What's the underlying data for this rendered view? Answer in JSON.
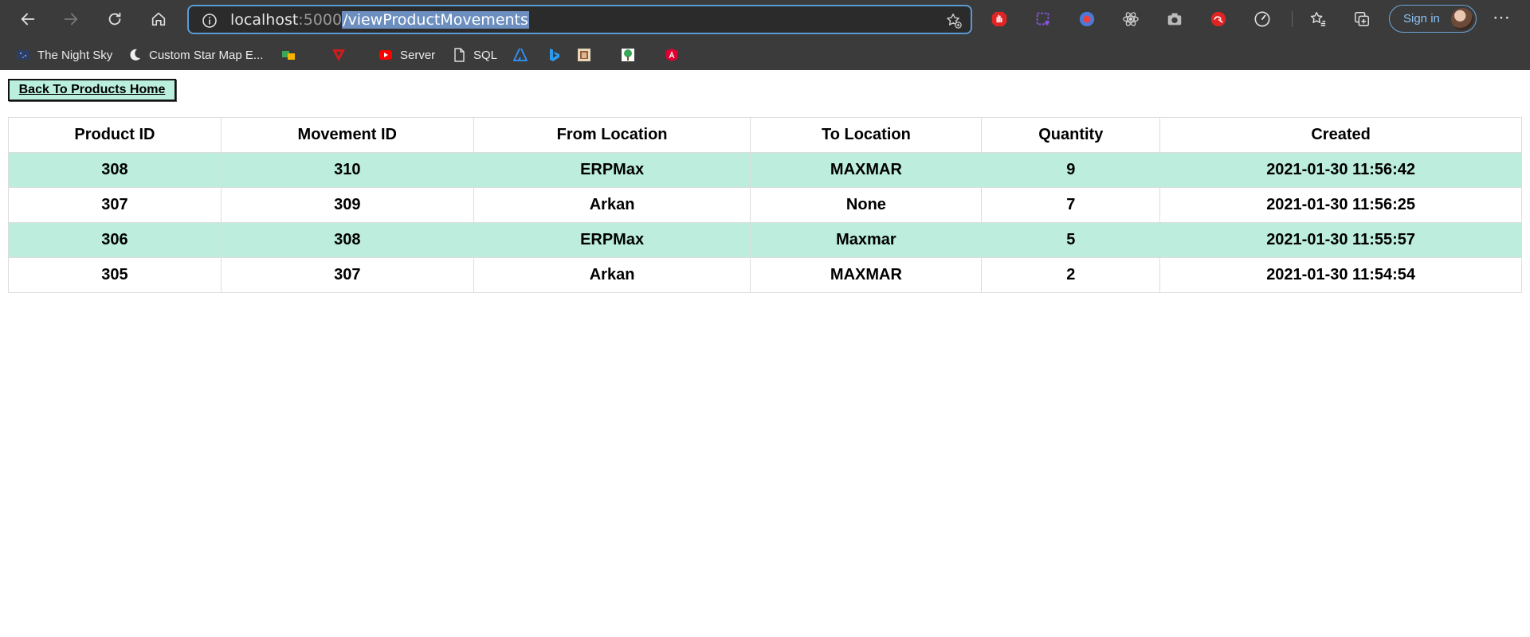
{
  "browser": {
    "url": {
      "host": "localhost",
      "port": ":5000",
      "path": "/viewProductMovements"
    },
    "signin_label": "Sign in",
    "bookmarks": [
      {
        "label": "The Night Sky",
        "icon": "night-sky-icon"
      },
      {
        "label": "Custom Star Map E...",
        "icon": "moon-icon"
      },
      {
        "label": "",
        "icon": "translate-icon"
      },
      {
        "label": "",
        "icon": "triangle-logo-icon"
      },
      {
        "label": "Server",
        "icon": "youtube-icon"
      },
      {
        "label": "SQL",
        "icon": "file-icon"
      },
      {
        "label": "",
        "icon": "azure-icon"
      },
      {
        "label": "",
        "icon": "bing-icon"
      },
      {
        "label": "",
        "icon": "image-thumbnail-icon"
      },
      {
        "label": "",
        "icon": "tree-icon"
      },
      {
        "label": "",
        "icon": "angular-icon"
      }
    ],
    "colors": {
      "chrome_bg": "#3b3b3b",
      "address_border": "#5b9bd5",
      "selection": "#6c8fc0"
    }
  },
  "page": {
    "back_button": "Back To Products Home",
    "table": {
      "headers": [
        "Product ID",
        "Movement ID",
        "From Location",
        "To Location",
        "Quantity",
        "Created"
      ],
      "rows": [
        [
          "308",
          "310",
          "ERPMax",
          "MAXMAR",
          "9",
          "2021-01-30 11:56:42"
        ],
        [
          "307",
          "309",
          "Arkan",
          "None",
          "7",
          "2021-01-30 11:56:25"
        ],
        [
          "306",
          "308",
          "ERPMax",
          "Maxmar",
          "5",
          "2021-01-30 11:55:57"
        ],
        [
          "305",
          "307",
          "Arkan",
          "MAXMAR",
          "2",
          "2021-01-30 11:54:54"
        ]
      ],
      "stripe_color": "#bdeedd"
    }
  }
}
